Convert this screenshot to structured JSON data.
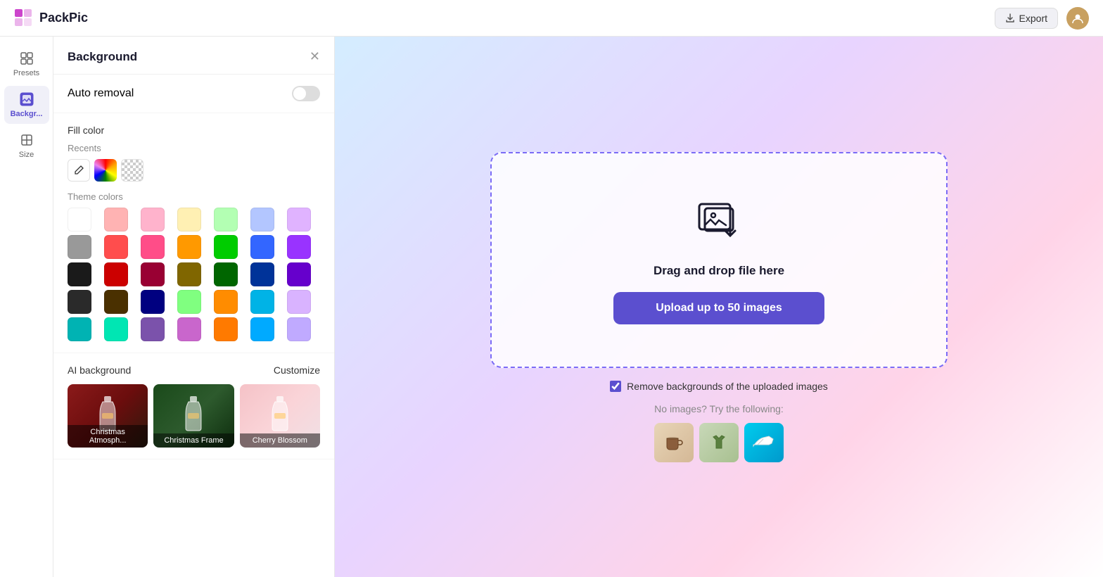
{
  "header": {
    "logo_text": "PackPic",
    "export_label": "Export"
  },
  "sidebar": {
    "items": [
      {
        "id": "presets",
        "label": "Presets",
        "icon": "layers"
      },
      {
        "id": "background",
        "label": "Backgr...",
        "icon": "image-fill",
        "active": true
      },
      {
        "id": "size",
        "label": "Size",
        "icon": "resize"
      }
    ]
  },
  "panel": {
    "title": "Background",
    "auto_removal": {
      "label": "Auto removal",
      "enabled": false
    },
    "fill_color": {
      "label": "Fill color",
      "recents_label": "Recents"
    },
    "theme_colors_label": "Theme colors",
    "colors": {
      "recents": [
        "pen",
        "rainbow",
        "checkered"
      ],
      "row1": [
        "#ffffff",
        "#ffb3b3",
        "#ffb3cc",
        "#fff0b3",
        "#b3ffb3",
        "#b3c6ff",
        "#e0b3ff"
      ],
      "row2": [
        "#999999",
        "#ff4d4d",
        "#ff4d88",
        "#ff9900",
        "#00cc00",
        "#3366ff",
        "#9933ff"
      ],
      "row3": [
        "#1a1a1a",
        "#cc0000",
        "#990033",
        "#806600",
        "#006600",
        "#003399",
        "#6600cc"
      ],
      "row4": [
        "#2a2a2a",
        "#4a3000",
        "#000080",
        "#80ff80",
        "#ff8c00",
        "#00b3e6",
        "#d9b3ff"
      ],
      "row5": [
        "#00b3b3",
        "#00e6b3",
        "#7b52ab",
        "#c966cc",
        "#ff7a00",
        "#00aaff",
        "#c0aaff"
      ]
    },
    "ai_background": {
      "label": "AI background",
      "customize_label": "Customize",
      "items": [
        {
          "id": "christmas-atmos",
          "label": "Christmas Atmosph...",
          "bg": "#8b1a1a"
        },
        {
          "id": "christmas-frame",
          "label": "Christmas Frame",
          "bg": "#2d5a2d"
        },
        {
          "id": "cherry-blossom",
          "label": "Cherry Blossom",
          "bg": "#f5c2c7"
        }
      ]
    }
  },
  "main": {
    "drag_text": "Drag and drop file here",
    "upload_btn_label": "Upload up to 50 images",
    "remove_bg_label": "Remove backgrounds of the uploaded images",
    "no_images_text": "No images? Try the following:",
    "remove_bg_checked": true
  }
}
